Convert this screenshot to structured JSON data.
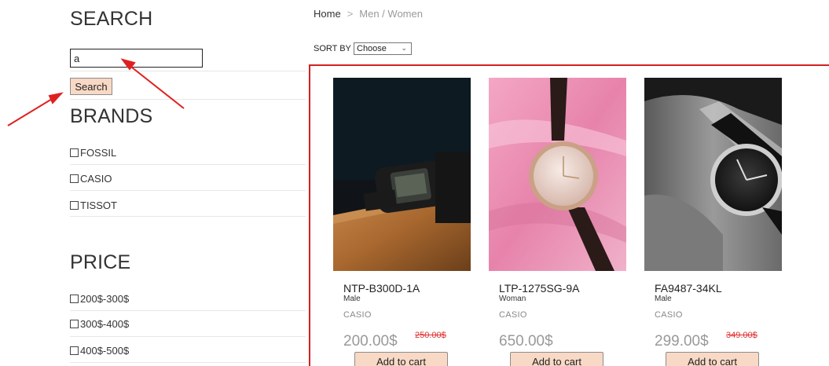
{
  "sidebar": {
    "search_title": "SEARCH",
    "search_value": "a",
    "search_button": "Search",
    "brands_title": "BRANDS",
    "brands": [
      "FOSSIL",
      "CASIO",
      "TISSOT"
    ],
    "price_title": "PRICE",
    "prices": [
      "200$-300$",
      "300$-400$",
      "400$-500$"
    ]
  },
  "breadcrumb": {
    "home": "Home",
    "separator": ">",
    "current": "Men / Women"
  },
  "sort": {
    "label": "SORT BY",
    "selected": "Choose"
  },
  "products": [
    {
      "name": "NTP-B300D-1A",
      "gender": "Male",
      "brand": "CASIO",
      "price": "200.00$",
      "old_price": "250.00$",
      "cart": "Add to cart"
    },
    {
      "name": "LTP-1275SG-9A",
      "gender": "Woman",
      "brand": "CASIO",
      "price": "650.00$",
      "old_price": "",
      "cart": "Add to cart"
    },
    {
      "name": "FA9487-34KL",
      "gender": "Male",
      "brand": "CASIO",
      "price": "299.00$",
      "old_price": "349.00$",
      "cart": "Add to cart"
    }
  ],
  "colors": {
    "accent_button": "#f8d9c5",
    "highlight_border": "#d42020",
    "sale_price": "#e03030",
    "annotation_arrow": "#e02020"
  }
}
